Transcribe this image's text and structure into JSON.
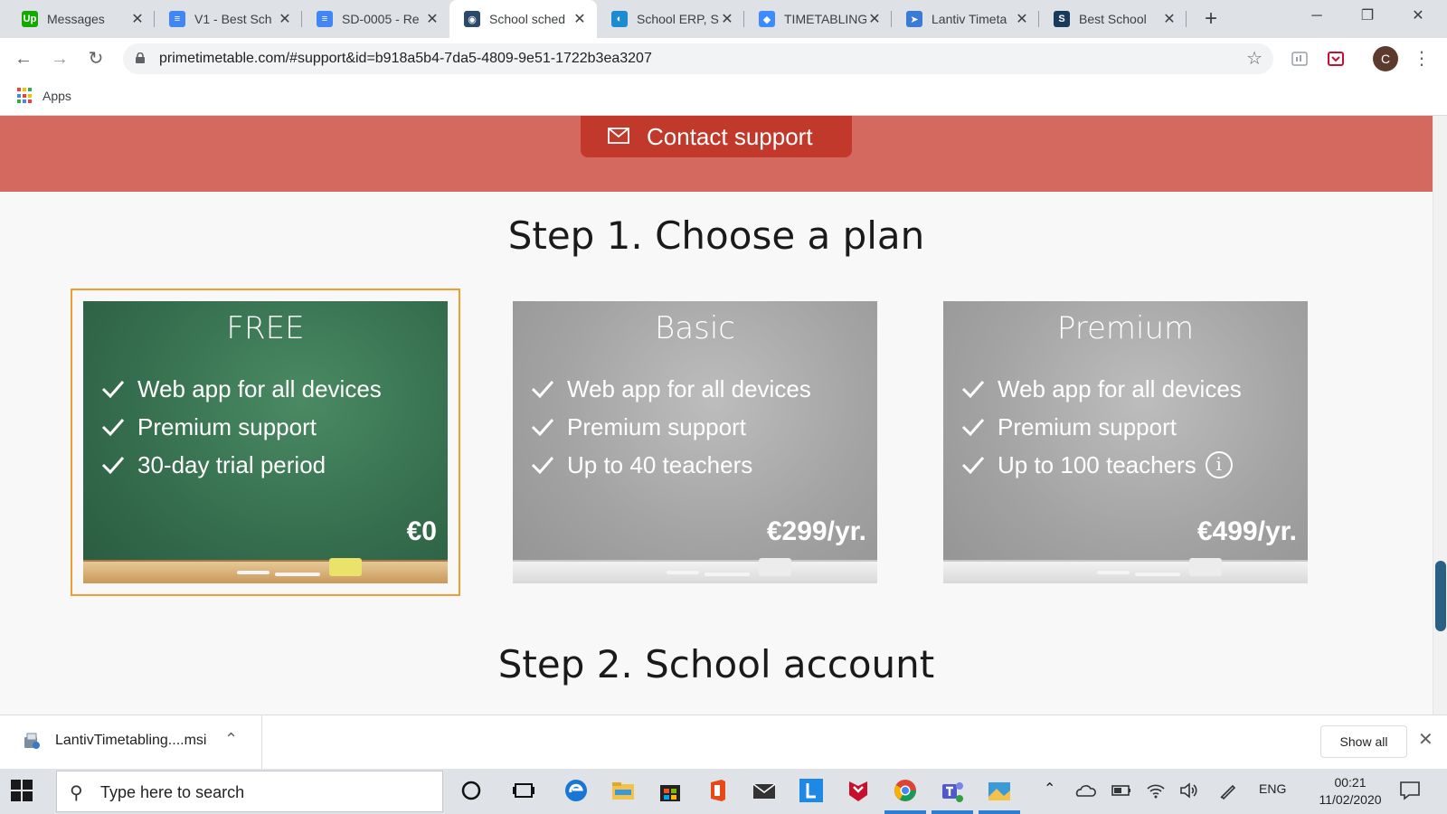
{
  "browser": {
    "tabs": [
      {
        "title": "Messages",
        "favicon": "upwork-icon",
        "color": "#14a800",
        "glyph": "Up"
      },
      {
        "title": "V1 - Best Sch",
        "favicon": "docs-icon",
        "color": "#4285f4",
        "glyph": "≡"
      },
      {
        "title": "SD-0005 - Re",
        "favicon": "docs-icon",
        "color": "#4285f4",
        "glyph": "≡"
      },
      {
        "title": "School sched",
        "favicon": "primetimetable-icon",
        "color": "#2b4a6b",
        "glyph": "◉"
      },
      {
        "title": "School ERP, S",
        "favicon": "erp-icon",
        "color": "#1c8bd1",
        "glyph": "◐"
      },
      {
        "title": "TIMETABLING",
        "favicon": "diamond-icon",
        "color": "#3d8bfd",
        "glyph": "◆"
      },
      {
        "title": "Lantiv Timeta",
        "favicon": "paper-plane-icon",
        "color": "#3a7bd5",
        "glyph": "➤"
      },
      {
        "title": "Best School",
        "favicon": "scribd-icon",
        "color": "#1a3a5c",
        "glyph": "S"
      }
    ],
    "active_tab": 3,
    "new_tab": "+",
    "url": "primetimetable.com/#support&id=b918a5b4-7da5-4809-9e51-1722b3ea3207",
    "profile_initial": "C",
    "bookmarks_apps_label": "Apps"
  },
  "page": {
    "contact_button": "Contact support",
    "step1_title": "Step 1. Choose a plan",
    "step2_title": "Step 2. School account",
    "plans": [
      {
        "name": "FREE",
        "features": [
          "Web app for all devices",
          "Premium support",
          "30-day trial period"
        ],
        "price": "€0",
        "selected": true,
        "theme": "green"
      },
      {
        "name": "Basic",
        "features": [
          "Web app for all devices",
          "Premium support",
          "Up to 40 teachers"
        ],
        "price": "€299/yr.",
        "selected": false,
        "theme": "grey"
      },
      {
        "name": "Premium",
        "features": [
          "Web app for all devices",
          "Premium support",
          "Up to 100 teachers"
        ],
        "price": "€499/yr.",
        "selected": false,
        "theme": "grey",
        "info_icon": true
      }
    ]
  },
  "download_bar": {
    "file_name": "LantivTimetabling....msi",
    "show_all": "Show all"
  },
  "taskbar": {
    "search_placeholder": "Type here to search",
    "language": "ENG",
    "time": "00:21",
    "date": "11/02/2020"
  },
  "colors": {
    "banner": "#d46a5f",
    "contact_button": "#c0392b",
    "selected_border": "#f39c34",
    "free_plan": "#356e4e",
    "paid_plan": "#a3a3a3"
  }
}
